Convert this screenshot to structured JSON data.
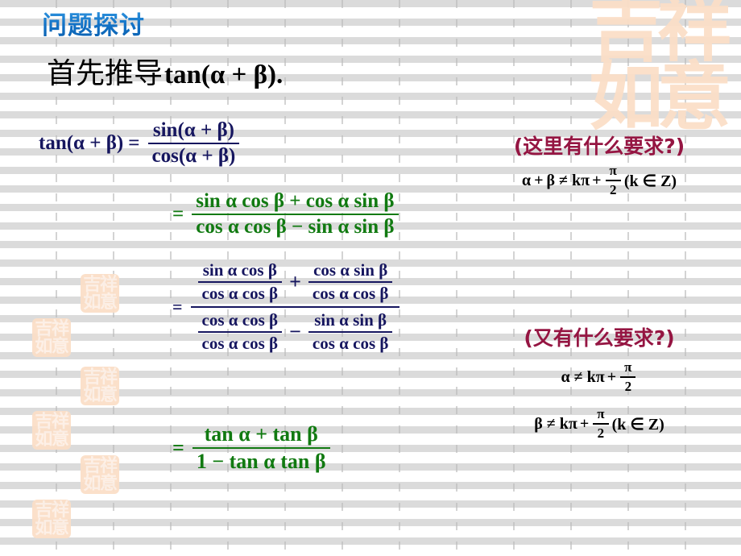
{
  "slide": {
    "title": "问题探讨",
    "title_color": "#1272c6",
    "lead_cn": "首先推导",
    "lead_math": "tan(α + β).",
    "background_color": "#ffffff",
    "grid": "vertical dashed gray columns"
  },
  "colors": {
    "navy": "#16165f",
    "green": "#117a11",
    "crimson": "#951542",
    "seal": "#fbdfc8",
    "gridline": "#bcbcbc"
  },
  "equations": {
    "line1": {
      "color": "#16165f",
      "lhs": "tan(α + β)",
      "equals": "=",
      "numerator": "sin(α + β)",
      "denominator": "cos(α + β)"
    },
    "line2": {
      "color": "#117a11",
      "equals": "=",
      "numerator": "sin α cos β + cos α sin β",
      "denominator": "cos α cos β − sin α sin β",
      "num_parts": {
        "left_fn1": "sin",
        "left_a": "α",
        "left_fn2": "cos",
        "left_b": "β",
        "op": "+",
        "right_fn1": "cos",
        "right_a": "α",
        "right_fn2": "sin",
        "right_b": "β"
      },
      "den_parts": {
        "left_fn1": "cos",
        "left_a": "α",
        "left_fn2": "cos",
        "left_b": "β",
        "op": "−",
        "right_fn1": "sin",
        "right_a": "α",
        "right_fn2": "sin",
        "right_b": "β"
      }
    },
    "line3": {
      "color": "#16165f",
      "equals": "=",
      "top_left": {
        "num": "sin α cos β",
        "den": "cos α cos β"
      },
      "top_op": "+",
      "top_right": {
        "num": "cos α sin β",
        "den": "cos α cos β"
      },
      "bot_left": {
        "num": "cos α cos β",
        "den": "cos α cos β"
      },
      "bot_op": "−",
      "bot_right": {
        "num": "sin α sin β",
        "den": "cos α cos β"
      }
    },
    "line4": {
      "color": "#117a11",
      "equals": "=",
      "numerator": "tan α + tan β",
      "denominator": "1 − tan α tan β",
      "num_parts": {
        "fn1": "tan",
        "a": "α",
        "op": "+",
        "fn2": "tan",
        "b": "β"
      },
      "den_parts": {
        "one": "1",
        "op": "−",
        "fn1": "tan",
        "a": "α",
        "fn2": "tan",
        "b": "β"
      }
    }
  },
  "notes": {
    "note1": {
      "question": "(这里有什么要求?)",
      "condition": "α + β ≠ kπ + π/2 (k ∈ Z)",
      "cond_parts": {
        "lhs_a": "α",
        "plus": "+",
        "lhs_b": "β",
        "neq": "≠",
        "k": "k",
        "pi": "π",
        "plus2": "+",
        "frac_num": "π",
        "frac_den": "2",
        "set": "(k ∈ Z)"
      }
    },
    "note2": {
      "question": "(又有什么要求?)",
      "condition_1": "α ≠ kπ + π/2",
      "condition_2": "β ≠ kπ + π/2 (k ∈ Z)",
      "cond1_parts": {
        "lhs": "α",
        "neq": "≠",
        "k": "k",
        "pi": "π",
        "plus": "+",
        "frac_num": "π",
        "frac_den": "2"
      },
      "cond2_parts": {
        "lhs": "β",
        "neq": "≠",
        "k": "k",
        "pi": "π",
        "plus": "+",
        "frac_num": "π",
        "frac_den": "2",
        "set": "(k ∈ Z)"
      }
    }
  },
  "decorations": {
    "seal_text_top": "吉祥",
    "seal_text_bottom": "如意",
    "seal_label": "吉祥如意 seal watermark"
  }
}
